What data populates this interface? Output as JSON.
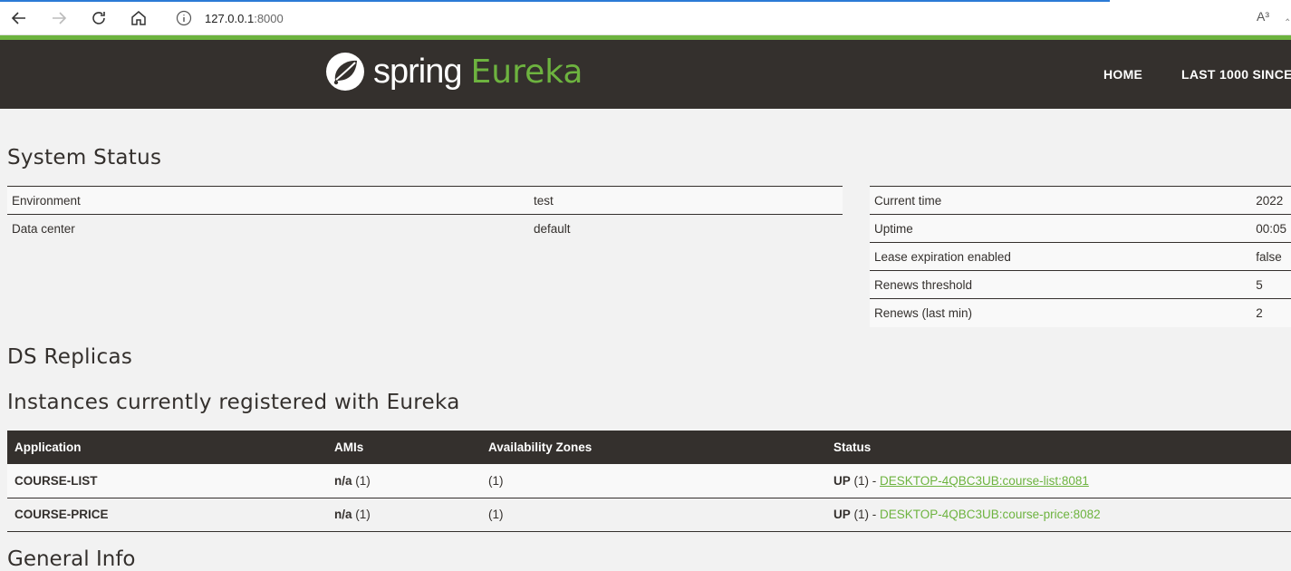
{
  "browser": {
    "url_host": "127.0.0.1",
    "url_port": ":8000",
    "read_aloud": "A³"
  },
  "header": {
    "logo_spring": "spring",
    "logo_eureka": "Eureka",
    "nav": [
      "HOME",
      "LAST 1000 SINCE"
    ]
  },
  "system_status": {
    "title": "System Status",
    "left": [
      {
        "label": "Environment",
        "value": "test"
      },
      {
        "label": "Data center",
        "value": "default"
      }
    ],
    "right": [
      {
        "label": "Current time",
        "value": "2022"
      },
      {
        "label": "Uptime",
        "value": "00:05"
      },
      {
        "label": "Lease expiration enabled",
        "value": "false"
      },
      {
        "label": "Renews threshold",
        "value": "5"
      },
      {
        "label": "Renews (last min)",
        "value": "2"
      }
    ]
  },
  "ds_replicas": {
    "title": "DS Replicas"
  },
  "instances": {
    "title": "Instances currently registered with Eureka",
    "columns": [
      "Application",
      "AMIs",
      "Availability Zones",
      "Status"
    ],
    "rows": [
      {
        "application": "COURSE-LIST",
        "ami_bold": "n/a",
        "ami_count": " (1)",
        "zones": "(1)",
        "status_bold": "UP",
        "status_count": " (1) - ",
        "link": "DESKTOP-4QBC3UB:course-list:8081"
      },
      {
        "application": "COURSE-PRICE",
        "ami_bold": "n/a",
        "ami_count": " (1)",
        "zones": "(1)",
        "status_bold": "UP",
        "status_count": " (1) - ",
        "link": "DESKTOP-4QBC3UB:course-price:8082"
      }
    ]
  },
  "general_info": {
    "title": "General Info"
  }
}
